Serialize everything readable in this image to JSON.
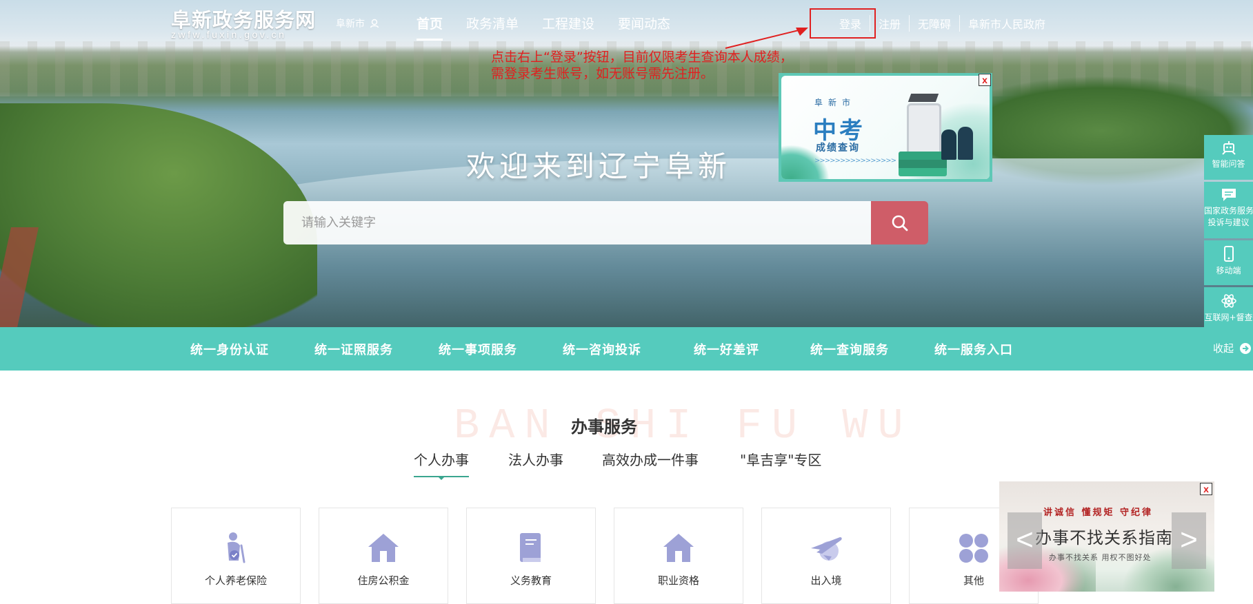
{
  "header": {
    "logo_title": "阜新政务服务网",
    "logo_subtitle": "zwfw.fuxin.gov.cn",
    "city": "阜新市",
    "nav": [
      "首页",
      "政务清单",
      "工程建设",
      "要闻动态"
    ],
    "nav_active": "首页",
    "top_links": [
      "登录",
      "注册",
      "无障碍",
      "阜新市人民政府"
    ]
  },
  "annotation": {
    "line1": "点击右上“登录”按钮，目前仅限考生查询本人成绩，",
    "line2": "需登录考生账号，如无账号需先注册。",
    "color": "#e02020"
  },
  "hero": {
    "welcome": "欢迎来到辽宁阜新",
    "search_placeholder": "请输入关键字"
  },
  "exam_popup": {
    "city": "阜新市",
    "title": "中考",
    "subtitle": "成绩查询",
    "chevrons": ">>>>>>>>>>>>>>>>",
    "close": "x"
  },
  "sidebar": [
    {
      "label": "智能问答",
      "icon": "robot-icon"
    },
    {
      "label": "国家政务服务投诉与建议",
      "line1": "国家政务服务",
      "line2": "投诉与建议",
      "icon": "chat-icon"
    },
    {
      "label": "移动端",
      "icon": "mobile-icon"
    },
    {
      "label": "互联网+督查",
      "icon": "atom-icon"
    }
  ],
  "service_bar": {
    "items": [
      "统一身份认证",
      "统一证照服务",
      "统一事项服务",
      "统一咨询投诉",
      "统一好差评",
      "统一查询服务",
      "统一服务入口"
    ],
    "collapse": "收起"
  },
  "section": {
    "bg_text": "BAN SHI FU WU",
    "title": "办事服务",
    "tabs": [
      "个人办事",
      "法人办事",
      "高效办成一件事",
      "\"阜吉享\"专区"
    ],
    "active_tab": "个人办事",
    "cards": [
      {
        "label": "个人养老保险",
        "icon": "elderly-icon"
      },
      {
        "label": "住房公积金",
        "icon": "house-icon"
      },
      {
        "label": "义务教育",
        "icon": "book-icon"
      },
      {
        "label": "职业资格",
        "icon": "house-icon"
      },
      {
        "label": "出入境",
        "icon": "plane-icon"
      },
      {
        "label": "其他",
        "icon": "grid-icon"
      }
    ]
  },
  "guide_popup": {
    "slogan": "讲诚信 懂规矩 守纪律",
    "title": "办事不找关系指南",
    "subtitle": "办事不找关系 用权不图好处",
    "prev": "<",
    "next": ">",
    "close": "x"
  },
  "colors": {
    "teal": "#55cbbd",
    "search_button": "#cf5d68",
    "accent_green": "#3aa58f",
    "icon_purple": "#9da1d6"
  }
}
